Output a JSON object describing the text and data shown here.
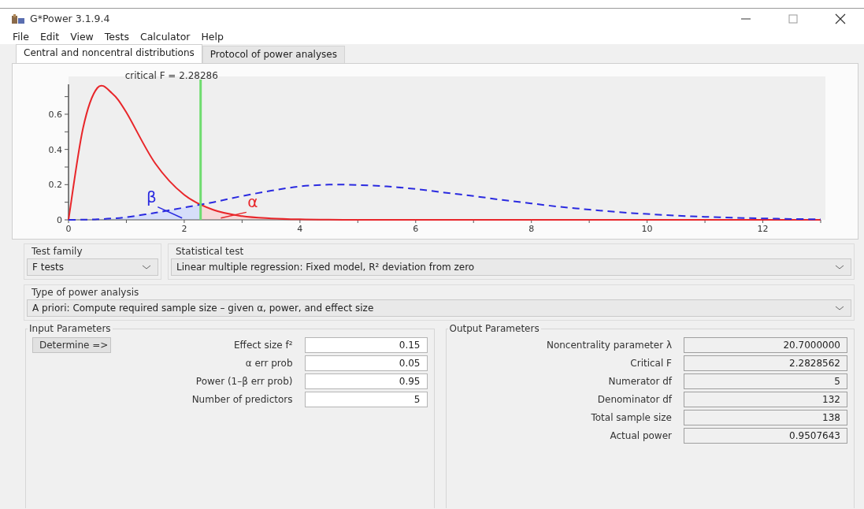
{
  "window": {
    "title": "G*Power 3.1.9.4"
  },
  "menu": [
    "File",
    "Edit",
    "View",
    "Tests",
    "Calculator",
    "Help"
  ],
  "tabs": [
    {
      "label": "Central and noncentral distributions",
      "selected": true
    },
    {
      "label": "Protocol of power analyses",
      "selected": false
    }
  ],
  "chart": {
    "chart_data": {
      "type": "line",
      "title": "critical F = 2.28286",
      "x": [
        0,
        0.25,
        0.5,
        0.75,
        1,
        1.5,
        2,
        2.5,
        3,
        3.5,
        4,
        4.5,
        5,
        5.5,
        6,
        6.5,
        7,
        7.5,
        8,
        8.5,
        9,
        9.5,
        10,
        10.5,
        11,
        11.5,
        12,
        12.5,
        13
      ],
      "series": [
        {
          "color": "#e8262a",
          "line_style": "solid",
          "values": [
            0,
            0.52,
            0.75,
            0.72,
            0.61,
            0.32,
            0.142,
            0.057,
            0.021,
            0.008,
            0.003,
            0.001,
            0,
            0,
            0,
            0,
            0,
            0,
            0,
            0,
            0,
            0,
            0,
            0,
            0,
            0,
            0,
            0,
            0
          ]
        },
        {
          "color": "#2a2ae0",
          "line_style": "dashed",
          "values": [
            0,
            0.001,
            0.003,
            0.008,
            0.015,
            0.04,
            0.07,
            0.1,
            0.135,
            0.165,
            0.19,
            0.2,
            0.198,
            0.19,
            0.175,
            0.155,
            0.135,
            0.113,
            0.093,
            0.074,
            0.058,
            0.044,
            0.033,
            0.024,
            0.017,
            0.012,
            0.008,
            0.005,
            0.003
          ]
        }
      ],
      "xlim": [
        0,
        13
      ],
      "ylim": [
        0,
        0.77
      ],
      "xticks": [
        0,
        2,
        4,
        6,
        8,
        10,
        12
      ],
      "yticks": [
        0,
        0.2,
        0.4,
        0.6
      ],
      "ref_lines": [
        {
          "axis": "x",
          "value": 2.28286,
          "color": "#6fdc6f"
        }
      ],
      "annotations": [
        "β",
        "α"
      ]
    }
  },
  "test_family": {
    "label": "Test family",
    "value": "F tests"
  },
  "statistical_test": {
    "label": "Statistical test",
    "value": "Linear multiple regression: Fixed model, R² deviation from zero"
  },
  "power_analysis": {
    "label": "Type of power analysis",
    "value": "A priori: Compute required sample size – given α, power, and effect size"
  },
  "input_parameters": {
    "title": "Input Parameters",
    "button": "Determine =>",
    "fields": [
      {
        "label": "Effect size f²",
        "value": "0.15"
      },
      {
        "label": "α err prob",
        "value": "0.05"
      },
      {
        "label": "Power (1–β err prob)",
        "value": "0.95"
      },
      {
        "label": "Number of predictors",
        "value": "5"
      }
    ]
  },
  "output_parameters": {
    "title": "Output Parameters",
    "fields": [
      {
        "label": "Noncentrality parameter λ",
        "value": "20.7000000"
      },
      {
        "label": "Critical F",
        "value": "2.2828562"
      },
      {
        "label": "Numerator df",
        "value": "5"
      },
      {
        "label": "Denominator df",
        "value": "132"
      },
      {
        "label": "Total sample size",
        "value": "138"
      },
      {
        "label": "Actual power",
        "value": "0.9507643"
      }
    ]
  }
}
